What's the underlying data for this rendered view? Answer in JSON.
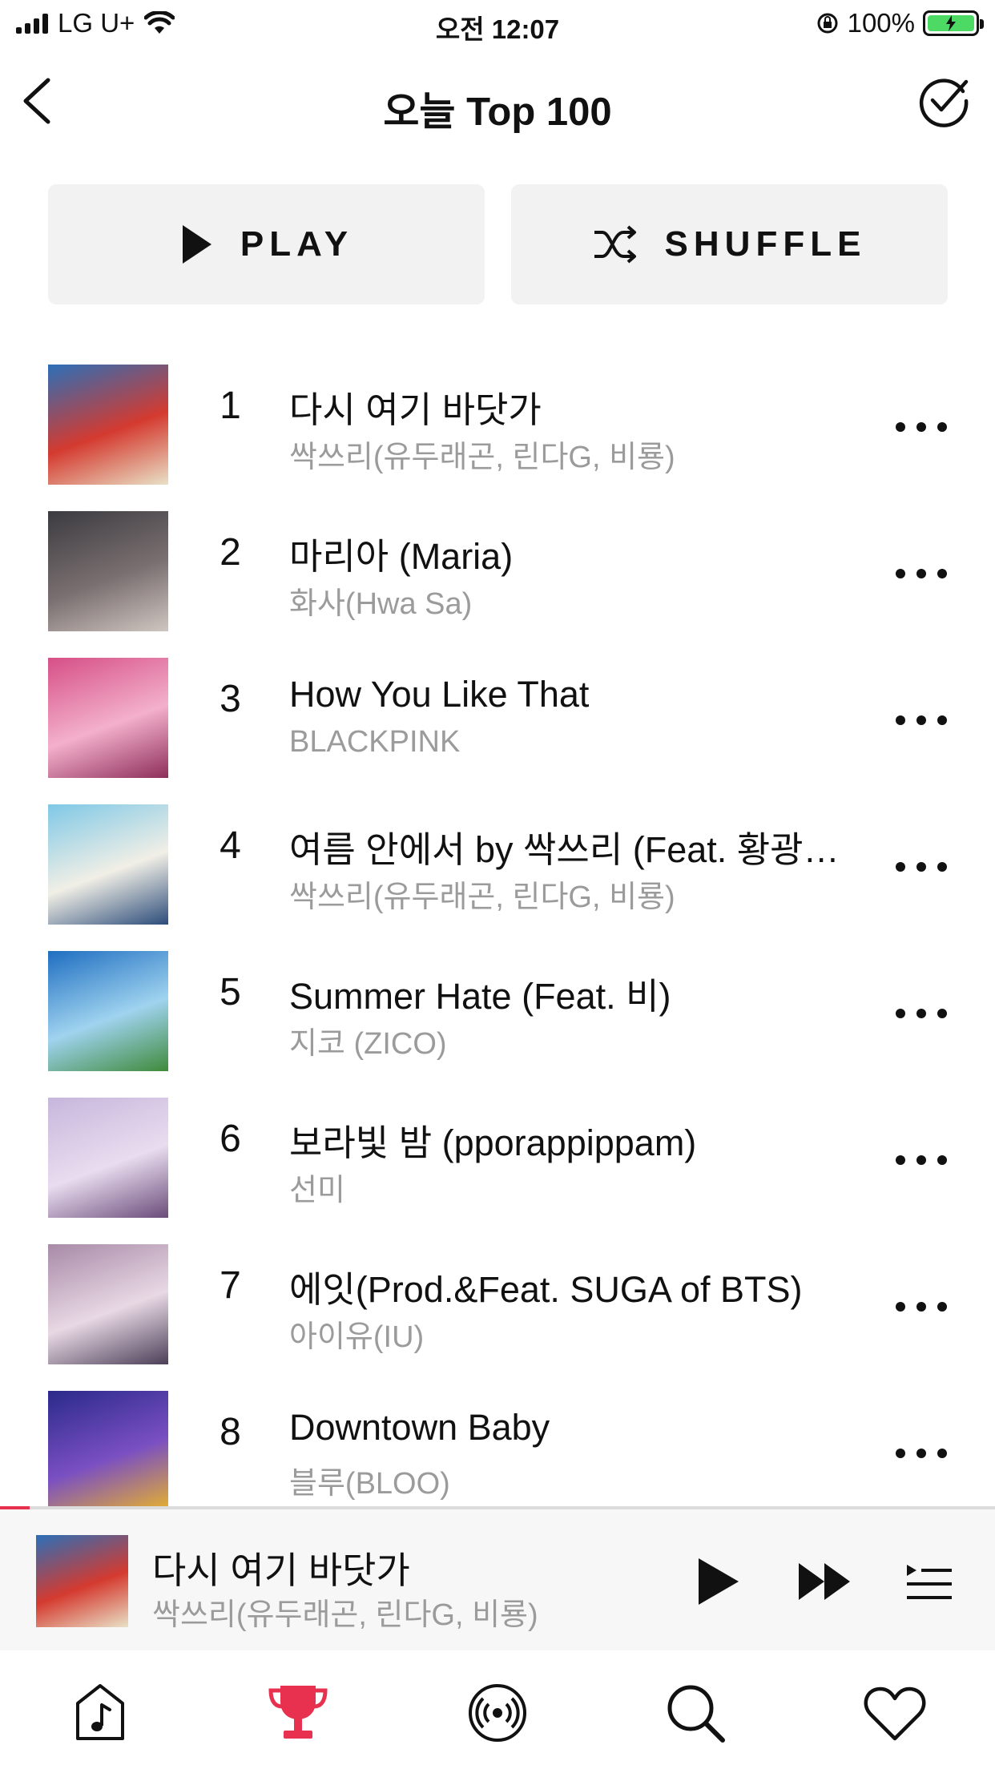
{
  "status_bar": {
    "carrier": "LG U+",
    "time": "오전 12:07",
    "battery": "100%"
  },
  "header": {
    "title": "오늘 Top 100",
    "icons": {
      "back": "chevron-left-icon",
      "select": "check-circle-icon"
    }
  },
  "actions": {
    "play_label": "PLAY",
    "shuffle_label": "SHUFFLE"
  },
  "tracks": [
    {
      "rank": "1",
      "title": "다시 여기 바닷가",
      "artist": "싹쓰리(유두래곤, 린다G, 비룡)",
      "cover_colors": [
        "#2b6fb8",
        "#d43a2f",
        "#e9e1c7"
      ]
    },
    {
      "rank": "2",
      "title": "마리아 (Maria)",
      "artist": "화사(Hwa Sa)",
      "cover_colors": [
        "#3b3b40",
        "#7a6f70",
        "#cfc5c0"
      ]
    },
    {
      "rank": "3",
      "title": "How You Like That",
      "artist": "BLACKPINK",
      "cover_colors": [
        "#d64f86",
        "#f3b0cc",
        "#8e2e5a"
      ]
    },
    {
      "rank": "4",
      "title": "여름 안에서 by 싹쓰리 (Feat. 황광…",
      "artist": "싹쓰리(유두래곤, 린다G, 비룡)",
      "cover_colors": [
        "#7fc8e6",
        "#f1efe6",
        "#2c4c7a"
      ]
    },
    {
      "rank": "5",
      "title": "Summer Hate (Feat. 비)",
      "artist": "지코 (ZICO)",
      "cover_colors": [
        "#1f6ec1",
        "#9fd3ef",
        "#3f8a3b"
      ]
    },
    {
      "rank": "6",
      "title": "보라빛 밤 (pporappippam)",
      "artist": "선미",
      "cover_colors": [
        "#c7b6dc",
        "#e9dcef",
        "#6a4c7a"
      ]
    },
    {
      "rank": "7",
      "title": "에잇(Prod.&Feat. SUGA of BTS)",
      "artist": "아이유(IU)",
      "cover_colors": [
        "#a88aa8",
        "#e8d8e4",
        "#4b3f58"
      ]
    },
    {
      "rank": "8",
      "title": "Downtown Baby",
      "artist": "블루(BLOO)",
      "cover_colors": [
        "#2a2a8a",
        "#7a4fc2",
        "#e7b12d"
      ]
    }
  ],
  "now_playing": {
    "title": "다시 여기 바닷가",
    "artist": "싹쓰리(유두래곤, 린다G, 비룡)",
    "progress": 0.03
  },
  "tab_bar": {
    "active": "chart",
    "tabs": [
      "music-note-icon",
      "trophy-icon",
      "radio-broadcast-icon",
      "search-icon",
      "heart-icon"
    ]
  },
  "colors": {
    "accent": "#e8304f",
    "muted_text": "#9b9b9b",
    "button_bg": "#f2f2f2"
  }
}
